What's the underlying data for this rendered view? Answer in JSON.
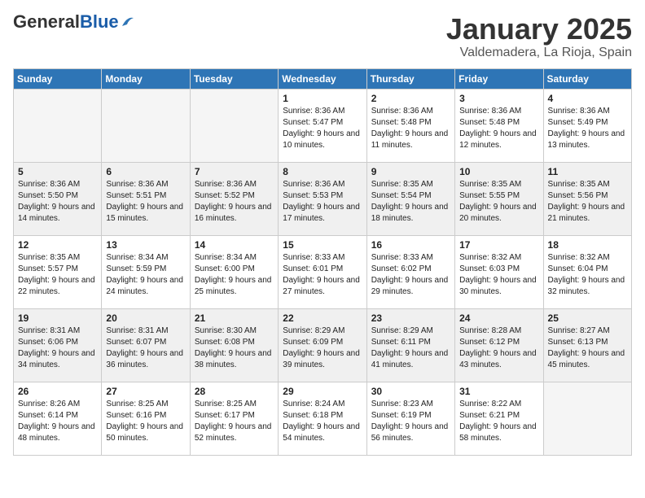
{
  "header": {
    "logo_general": "General",
    "logo_blue": "Blue",
    "title": "January 2025",
    "location": "Valdemadera, La Rioja, Spain"
  },
  "weekdays": [
    "Sunday",
    "Monday",
    "Tuesday",
    "Wednesday",
    "Thursday",
    "Friday",
    "Saturday"
  ],
  "weeks": [
    [
      {
        "day": "",
        "empty": true
      },
      {
        "day": "",
        "empty": true
      },
      {
        "day": "",
        "empty": true
      },
      {
        "day": "1",
        "sunrise": "Sunrise: 8:36 AM",
        "sunset": "Sunset: 5:47 PM",
        "daylight": "Daylight: 9 hours and 10 minutes."
      },
      {
        "day": "2",
        "sunrise": "Sunrise: 8:36 AM",
        "sunset": "Sunset: 5:48 PM",
        "daylight": "Daylight: 9 hours and 11 minutes."
      },
      {
        "day": "3",
        "sunrise": "Sunrise: 8:36 AM",
        "sunset": "Sunset: 5:48 PM",
        "daylight": "Daylight: 9 hours and 12 minutes."
      },
      {
        "day": "4",
        "sunrise": "Sunrise: 8:36 AM",
        "sunset": "Sunset: 5:49 PM",
        "daylight": "Daylight: 9 hours and 13 minutes."
      }
    ],
    [
      {
        "day": "5",
        "sunrise": "Sunrise: 8:36 AM",
        "sunset": "Sunset: 5:50 PM",
        "daylight": "Daylight: 9 hours and 14 minutes."
      },
      {
        "day": "6",
        "sunrise": "Sunrise: 8:36 AM",
        "sunset": "Sunset: 5:51 PM",
        "daylight": "Daylight: 9 hours and 15 minutes."
      },
      {
        "day": "7",
        "sunrise": "Sunrise: 8:36 AM",
        "sunset": "Sunset: 5:52 PM",
        "daylight": "Daylight: 9 hours and 16 minutes."
      },
      {
        "day": "8",
        "sunrise": "Sunrise: 8:36 AM",
        "sunset": "Sunset: 5:53 PM",
        "daylight": "Daylight: 9 hours and 17 minutes."
      },
      {
        "day": "9",
        "sunrise": "Sunrise: 8:35 AM",
        "sunset": "Sunset: 5:54 PM",
        "daylight": "Daylight: 9 hours and 18 minutes."
      },
      {
        "day": "10",
        "sunrise": "Sunrise: 8:35 AM",
        "sunset": "Sunset: 5:55 PM",
        "daylight": "Daylight: 9 hours and 20 minutes."
      },
      {
        "day": "11",
        "sunrise": "Sunrise: 8:35 AM",
        "sunset": "Sunset: 5:56 PM",
        "daylight": "Daylight: 9 hours and 21 minutes."
      }
    ],
    [
      {
        "day": "12",
        "sunrise": "Sunrise: 8:35 AM",
        "sunset": "Sunset: 5:57 PM",
        "daylight": "Daylight: 9 hours and 22 minutes."
      },
      {
        "day": "13",
        "sunrise": "Sunrise: 8:34 AM",
        "sunset": "Sunset: 5:59 PM",
        "daylight": "Daylight: 9 hours and 24 minutes."
      },
      {
        "day": "14",
        "sunrise": "Sunrise: 8:34 AM",
        "sunset": "Sunset: 6:00 PM",
        "daylight": "Daylight: 9 hours and 25 minutes."
      },
      {
        "day": "15",
        "sunrise": "Sunrise: 8:33 AM",
        "sunset": "Sunset: 6:01 PM",
        "daylight": "Daylight: 9 hours and 27 minutes."
      },
      {
        "day": "16",
        "sunrise": "Sunrise: 8:33 AM",
        "sunset": "Sunset: 6:02 PM",
        "daylight": "Daylight: 9 hours and 29 minutes."
      },
      {
        "day": "17",
        "sunrise": "Sunrise: 8:32 AM",
        "sunset": "Sunset: 6:03 PM",
        "daylight": "Daylight: 9 hours and 30 minutes."
      },
      {
        "day": "18",
        "sunrise": "Sunrise: 8:32 AM",
        "sunset": "Sunset: 6:04 PM",
        "daylight": "Daylight: 9 hours and 32 minutes."
      }
    ],
    [
      {
        "day": "19",
        "sunrise": "Sunrise: 8:31 AM",
        "sunset": "Sunset: 6:06 PM",
        "daylight": "Daylight: 9 hours and 34 minutes."
      },
      {
        "day": "20",
        "sunrise": "Sunrise: 8:31 AM",
        "sunset": "Sunset: 6:07 PM",
        "daylight": "Daylight: 9 hours and 36 minutes."
      },
      {
        "day": "21",
        "sunrise": "Sunrise: 8:30 AM",
        "sunset": "Sunset: 6:08 PM",
        "daylight": "Daylight: 9 hours and 38 minutes."
      },
      {
        "day": "22",
        "sunrise": "Sunrise: 8:29 AM",
        "sunset": "Sunset: 6:09 PM",
        "daylight": "Daylight: 9 hours and 39 minutes."
      },
      {
        "day": "23",
        "sunrise": "Sunrise: 8:29 AM",
        "sunset": "Sunset: 6:11 PM",
        "daylight": "Daylight: 9 hours and 41 minutes."
      },
      {
        "day": "24",
        "sunrise": "Sunrise: 8:28 AM",
        "sunset": "Sunset: 6:12 PM",
        "daylight": "Daylight: 9 hours and 43 minutes."
      },
      {
        "day": "25",
        "sunrise": "Sunrise: 8:27 AM",
        "sunset": "Sunset: 6:13 PM",
        "daylight": "Daylight: 9 hours and 45 minutes."
      }
    ],
    [
      {
        "day": "26",
        "sunrise": "Sunrise: 8:26 AM",
        "sunset": "Sunset: 6:14 PM",
        "daylight": "Daylight: 9 hours and 48 minutes."
      },
      {
        "day": "27",
        "sunrise": "Sunrise: 8:25 AM",
        "sunset": "Sunset: 6:16 PM",
        "daylight": "Daylight: 9 hours and 50 minutes."
      },
      {
        "day": "28",
        "sunrise": "Sunrise: 8:25 AM",
        "sunset": "Sunset: 6:17 PM",
        "daylight": "Daylight: 9 hours and 52 minutes."
      },
      {
        "day": "29",
        "sunrise": "Sunrise: 8:24 AM",
        "sunset": "Sunset: 6:18 PM",
        "daylight": "Daylight: 9 hours and 54 minutes."
      },
      {
        "day": "30",
        "sunrise": "Sunrise: 8:23 AM",
        "sunset": "Sunset: 6:19 PM",
        "daylight": "Daylight: 9 hours and 56 minutes."
      },
      {
        "day": "31",
        "sunrise": "Sunrise: 8:22 AM",
        "sunset": "Sunset: 6:21 PM",
        "daylight": "Daylight: 9 hours and 58 minutes."
      },
      {
        "day": "",
        "empty": true
      }
    ]
  ]
}
